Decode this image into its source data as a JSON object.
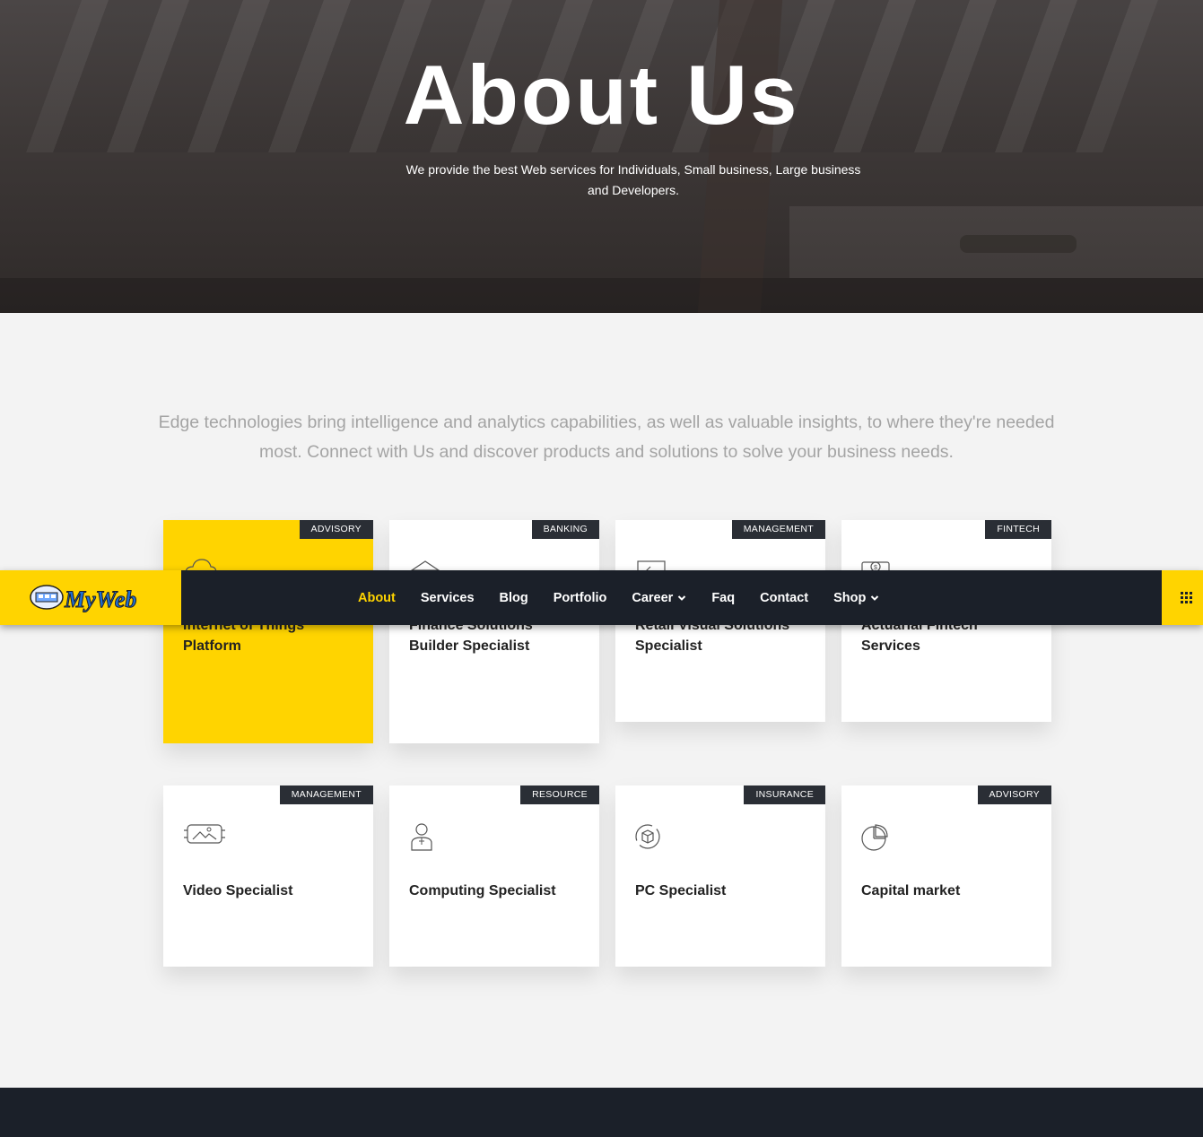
{
  "hero": {
    "title": "About Us",
    "subtitle": "We provide the best Web services for Individuals, Small business, Large business and Developers."
  },
  "intro": {
    "text": "Edge technologies bring intelligence and analytics capabilities, as well as valuable insights, to where they're needed most. Connect with Us and discover products and solutions to solve your business needs."
  },
  "cards": [
    {
      "tag": "ADVISORY",
      "title": "Internet of Things Platform",
      "icon": "cloud-icon"
    },
    {
      "tag": "BANKING",
      "title": "Finance Solutions Builder Specialist",
      "icon": "bank-icon"
    },
    {
      "tag": "MANAGEMENT",
      "title": "Retail Visual Solutions Specialist",
      "icon": "chart-board-icon"
    },
    {
      "tag": "FINTECH",
      "title": "Actuarial Fintech Services",
      "icon": "money-icon"
    },
    {
      "tag": "MANAGEMENT",
      "title": "Video Specialist",
      "icon": "video-image-icon"
    },
    {
      "tag": "RESOURCE",
      "title": "Computing Specialist",
      "icon": "person-icon"
    },
    {
      "tag": "INSURANCE",
      "title": "PC Specialist",
      "icon": "cube-cycle-icon"
    },
    {
      "tag": "ADVISORY",
      "title": "Capital market",
      "icon": "pie-chart-icon"
    }
  ],
  "nav": {
    "logo_text": "MyWeb",
    "items": [
      "About",
      "Services",
      "Blog",
      "Portfolio",
      "Career",
      "Faq",
      "Contact",
      "Shop"
    ],
    "active": "About",
    "menu_icon": "grid-menu-icon"
  },
  "colors": {
    "accent": "#ffd400",
    "dark": "#1b2029",
    "tag_bg": "#2a2e35"
  }
}
